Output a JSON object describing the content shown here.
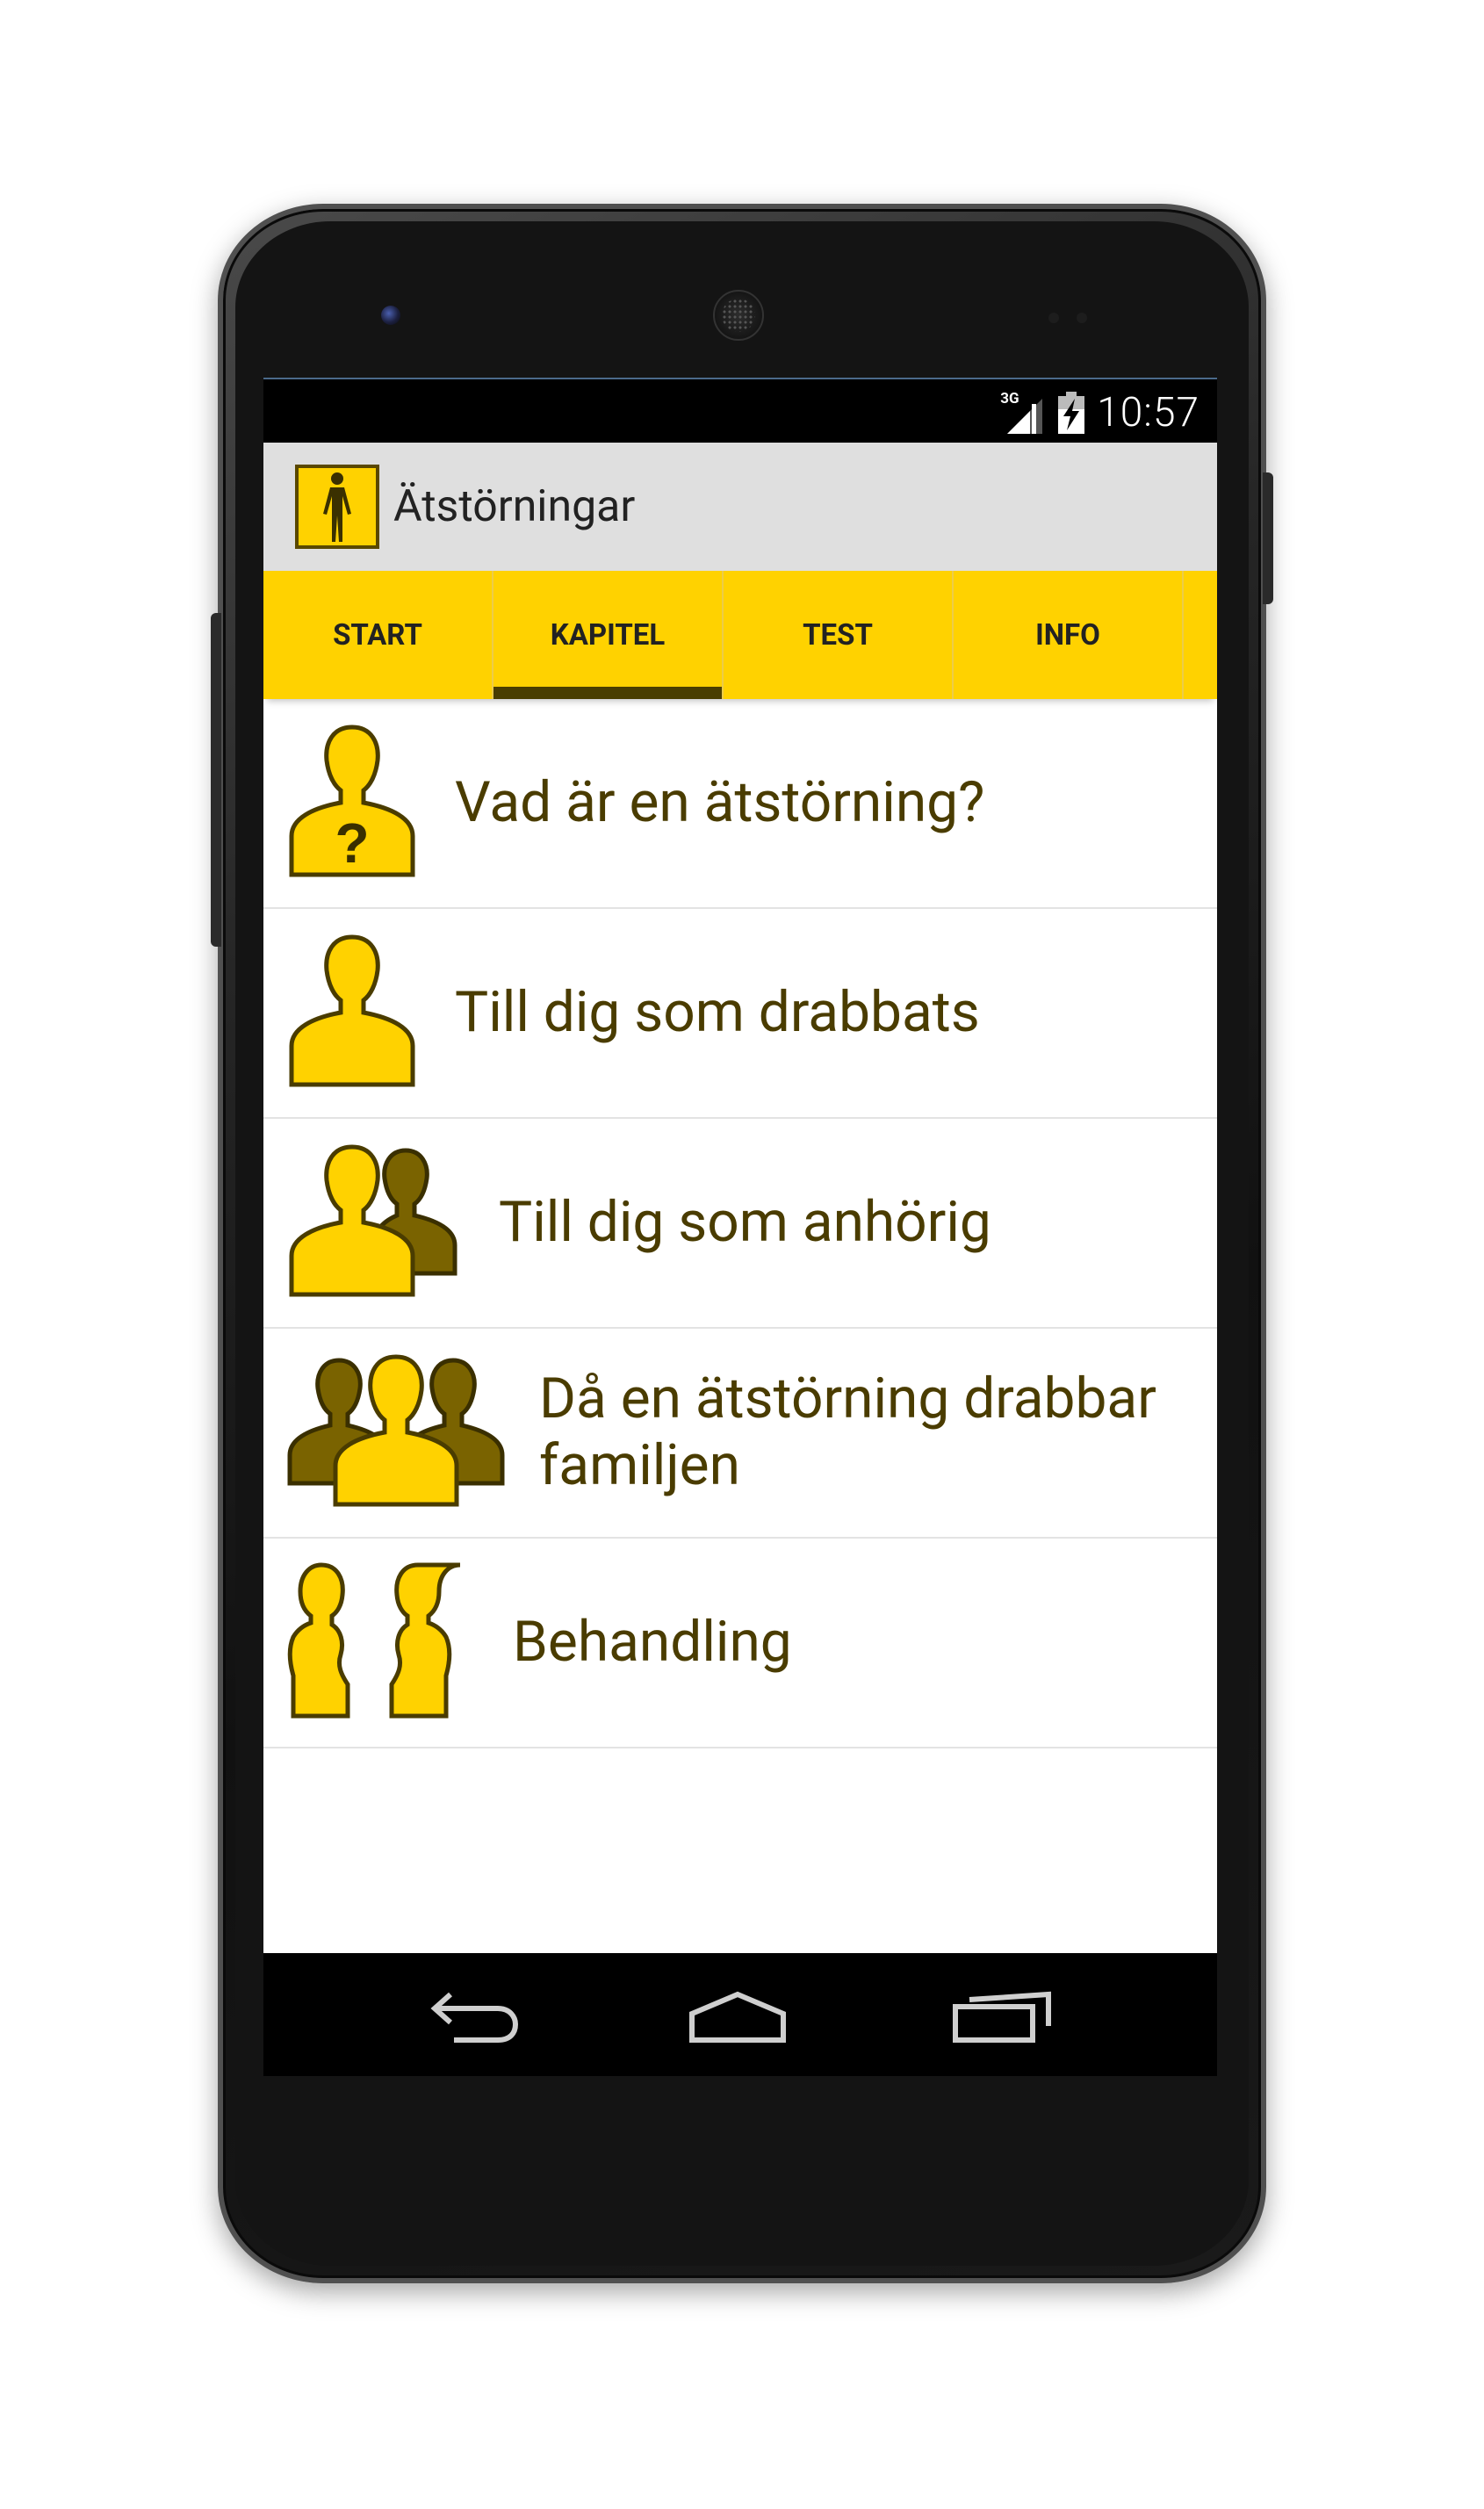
{
  "status_bar": {
    "network_type": "3G",
    "time": "10:57"
  },
  "action_bar": {
    "title": "Ätstörningar"
  },
  "tabs": [
    {
      "label": "START"
    },
    {
      "label": "KAPITEL"
    },
    {
      "label": "TEST"
    },
    {
      "label": "INFO"
    }
  ],
  "chapters": [
    {
      "label": "Vad är en ätstörning?",
      "icon": "person-question-icon"
    },
    {
      "label": "Till dig som drabbats",
      "icon": "person-icon"
    },
    {
      "label": "Till dig som anhörig",
      "icon": "two-persons-icon"
    },
    {
      "label": "Då en ätstörning drabbar familjen",
      "icon": "family-icon"
    },
    {
      "label": "Behandling",
      "icon": "two-profiles-icon"
    }
  ],
  "colors": {
    "accent": "#ffd200",
    "dark_accent": "#4a3e00",
    "icon_dark": "#7a6300",
    "text": "#4a3c00"
  }
}
